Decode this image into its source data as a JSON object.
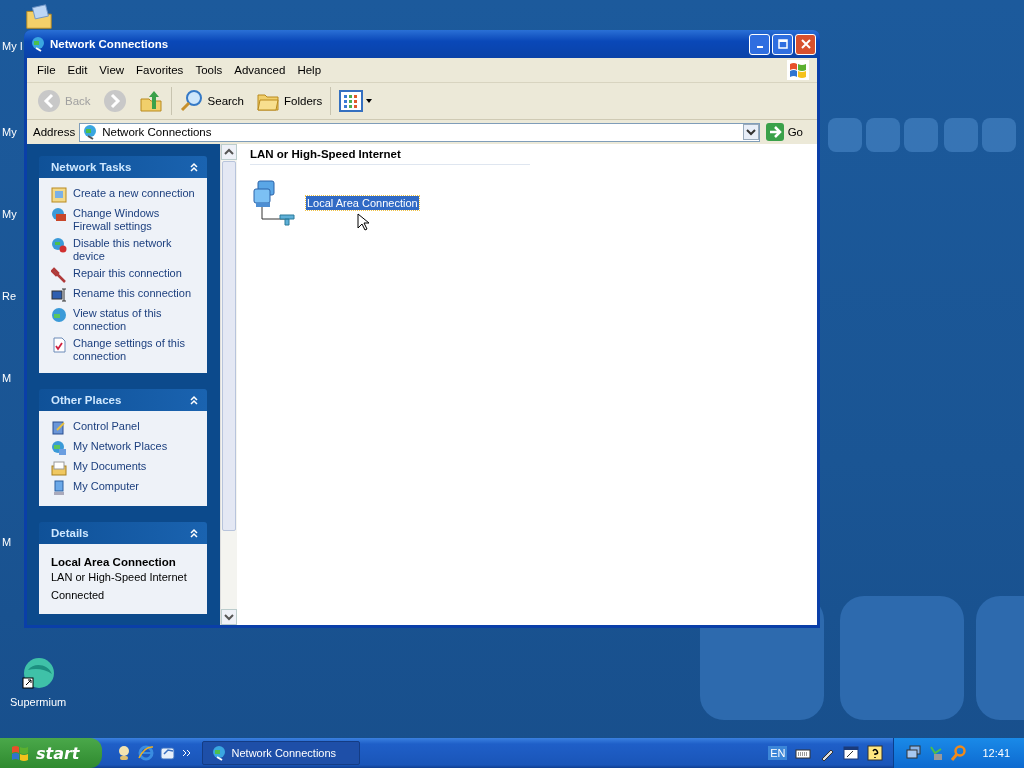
{
  "desktop": {
    "icons": [
      {
        "label": "My I"
      },
      {
        "label": "My"
      },
      {
        "label": "My"
      },
      {
        "label": "Re"
      },
      {
        "label": "M"
      },
      {
        "label": "M"
      }
    ],
    "shortcut": {
      "label": "Supermium"
    }
  },
  "window": {
    "title": "Network Connections",
    "menu": [
      "File",
      "Edit",
      "View",
      "Favorites",
      "Tools",
      "Advanced",
      "Help"
    ],
    "toolbar": [
      {
        "kind": "back",
        "label": "Back",
        "disabled": true
      },
      {
        "kind": "forward",
        "disabled": true
      },
      {
        "kind": "up"
      },
      {
        "kind": "search",
        "label": "Search"
      },
      {
        "kind": "folders",
        "label": "Folders"
      },
      {
        "kind": "views"
      }
    ],
    "address": {
      "label": "Address",
      "value": "Network Connections",
      "go": "Go"
    }
  },
  "task_panes": [
    {
      "title": "Network Tasks",
      "kind": "links",
      "items": [
        {
          "text": "Create a new connection"
        },
        {
          "text": "Change Windows Firewall settings"
        },
        {
          "text": "Disable this network device"
        },
        {
          "text": "Repair this connection"
        },
        {
          "text": "Rename this connection"
        },
        {
          "text": "View status of this connection"
        },
        {
          "text": "Change settings of this connection"
        }
      ]
    },
    {
      "title": "Other Places",
      "kind": "links",
      "items": [
        {
          "text": "Control Panel"
        },
        {
          "text": "My Network Places"
        },
        {
          "text": "My Documents"
        },
        {
          "text": "My Computer"
        }
      ]
    },
    {
      "title": "Details",
      "kind": "details",
      "name": "Local Area Connection",
      "type": "LAN or High-Speed Internet",
      "status": "Connected"
    }
  ],
  "content": {
    "group": "LAN or High-Speed Internet",
    "items": [
      {
        "label": "Local Area Connection",
        "selected": true
      }
    ]
  },
  "taskbar": {
    "start": "start",
    "tasks": [
      {
        "title": "Network Connections",
        "selected": false
      }
    ],
    "language": "EN",
    "clock": "12:41"
  }
}
